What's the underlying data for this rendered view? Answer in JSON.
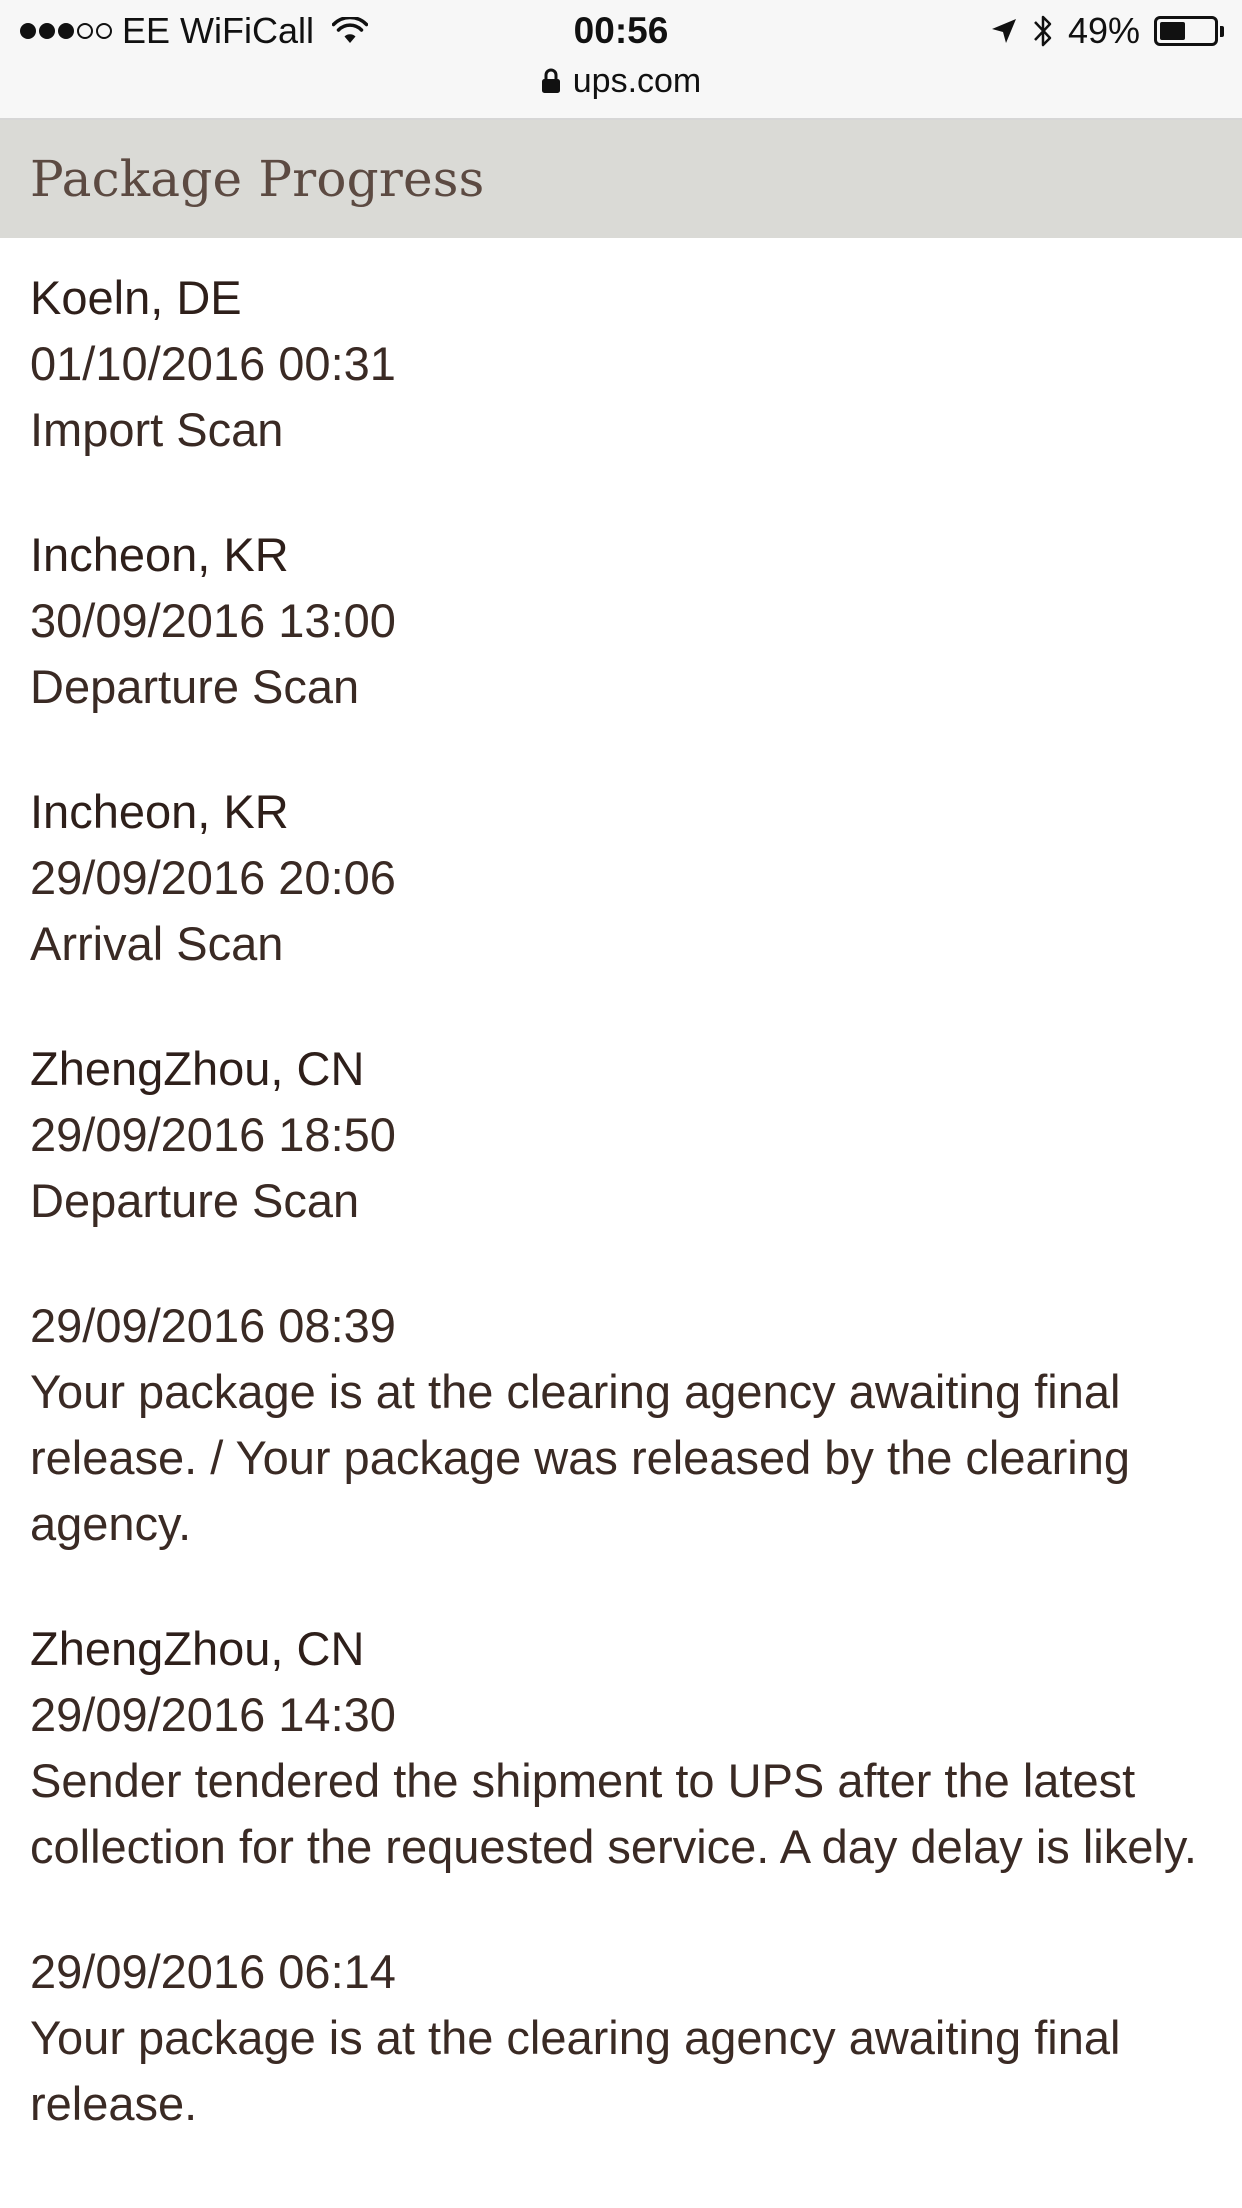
{
  "status_bar": {
    "carrier": "EE WiFiCall",
    "signal_bars_filled": 3,
    "signal_bars_total": 5,
    "time": "00:56",
    "battery_percent_label": "49%",
    "battery_level": 0.49
  },
  "address_bar": {
    "url": "ups.com"
  },
  "page": {
    "title": "Package Progress"
  },
  "progress": [
    {
      "location": "Koeln, DE",
      "datetime": "01/10/2016 00:31",
      "activity": "Import Scan"
    },
    {
      "location": "Incheon, KR",
      "datetime": "30/09/2016 13:00",
      "activity": "Departure Scan"
    },
    {
      "location": "Incheon, KR",
      "datetime": "29/09/2016 20:06",
      "activity": "Arrival Scan"
    },
    {
      "location": "ZhengZhou, CN",
      "datetime": "29/09/2016 18:50",
      "activity": "Departure Scan"
    },
    {
      "location": "",
      "datetime": "29/09/2016 08:39",
      "activity": "Your package is at the clearing agency awaiting final release. / Your package was released by the clearing agency."
    },
    {
      "location": "ZhengZhou, CN",
      "datetime": "29/09/2016 14:30",
      "activity": "Sender tendered the shipment to UPS after the latest collection for the requested service. A day delay is likely."
    },
    {
      "location": "",
      "datetime": "29/09/2016 06:14",
      "activity": "Your package is at the clearing agency awaiting final release."
    }
  ]
}
